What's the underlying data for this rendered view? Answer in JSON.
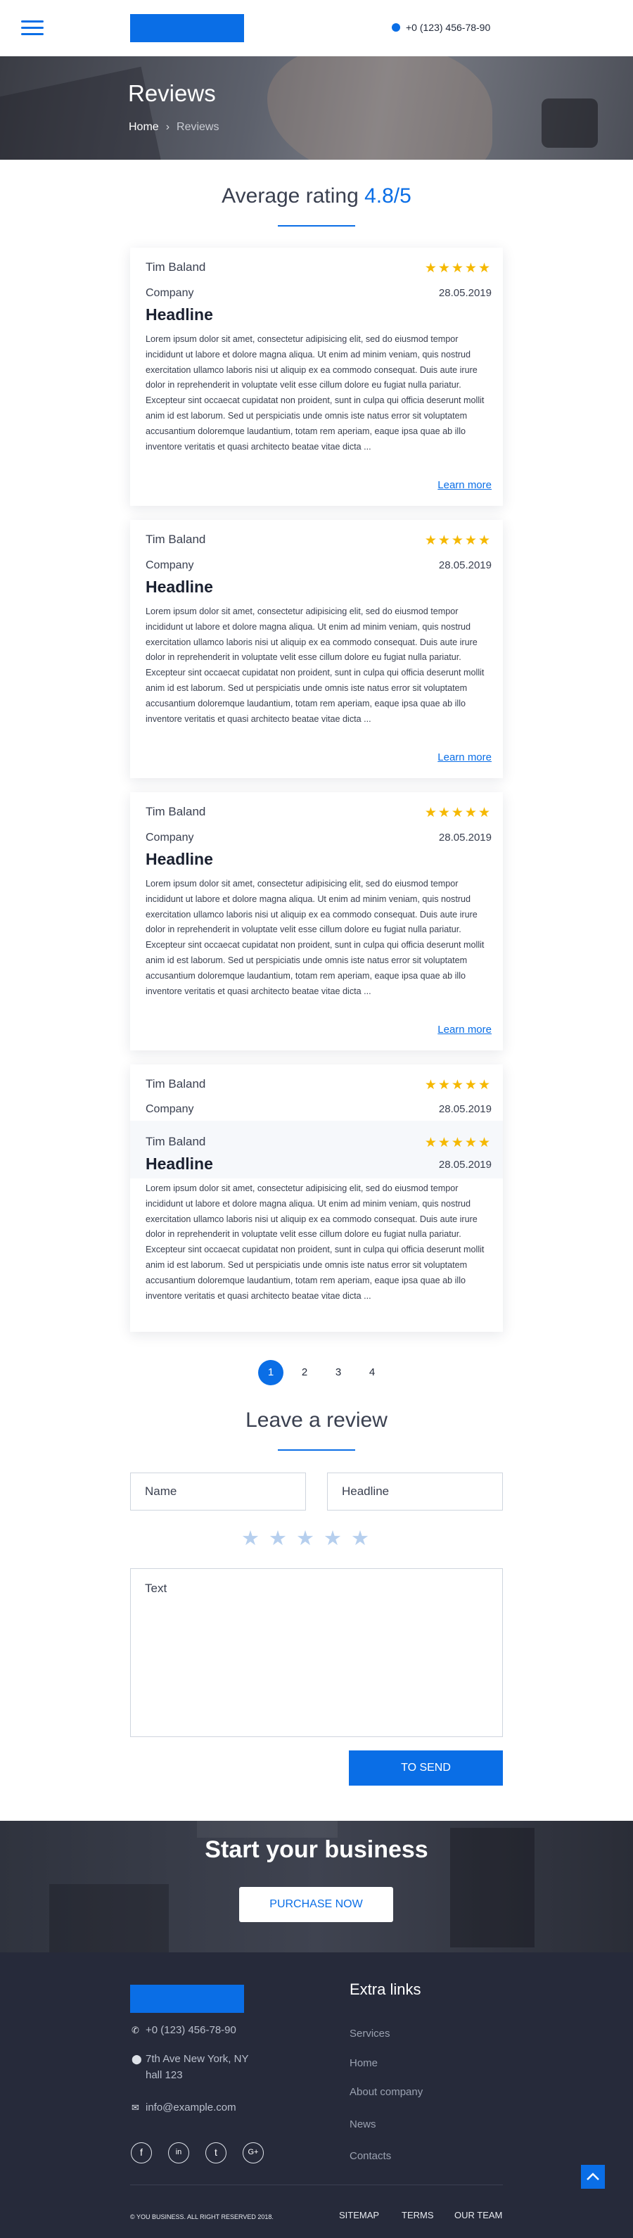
{
  "header": {
    "phone": "+0 (123) 456-78-90"
  },
  "hero": {
    "title": "Reviews",
    "breadcrumb": {
      "home": "Home",
      "separator": "›",
      "current": "Reviews"
    }
  },
  "average": {
    "label": "Average rating",
    "value": "4.8/5"
  },
  "reviews": [
    {
      "name": "Tim Baland",
      "stars": "★★★★★",
      "company": "Company",
      "date": "28.05.2019",
      "headline": "Headline",
      "body": "Lorem ipsum dolor sit amet, consectetur adipisicing elit, sed do eiusmod tempor incididunt ut labore et dolore magna aliqua. Ut enim ad minim veniam, quis nostrud exercitation ullamco laboris nisi ut aliquip ex ea commodo consequat. Duis aute irure dolor in reprehenderit in voluptate velit esse cillum dolore eu fugiat nulla pariatur. Excepteur sint occaecat cupidatat non proident, sunt in culpa qui officia deserunt mollit anim id est laborum. Sed ut perspiciatis unde omnis iste natus error sit voluptatem accusantium doloremque laudantium, totam rem aperiam, eaque ipsa quae ab illo inventore veritatis et quasi architecto beatae vitae dicta ...",
      "more": "Learn more"
    },
    {
      "name": "Tim Baland",
      "stars": "★★★★★",
      "company": "Company",
      "date": "28.05.2019",
      "headline": "Headline",
      "body": "Lorem ipsum dolor sit amet, consectetur adipisicing elit, sed do eiusmod tempor incididunt ut labore et dolore magna aliqua. Ut enim ad minim veniam, quis nostrud exercitation ullamco laboris nisi ut aliquip ex ea commodo consequat. Duis aute irure dolor in reprehenderit in voluptate velit esse cillum dolore eu fugiat nulla pariatur. Excepteur sint occaecat cupidatat non proident, sunt in culpa qui officia deserunt mollit anim id est laborum. Sed ut perspiciatis unde omnis iste natus error sit voluptatem accusantium doloremque laudantium, totam rem aperiam, eaque ipsa quae ab illo inventore veritatis et quasi architecto beatae vitae dicta ...",
      "more": "Learn more"
    },
    {
      "name": "Tim Baland",
      "stars": "★★★★★",
      "company": "Company",
      "date": "28.05.2019",
      "headline": "Headline",
      "body": "Lorem ipsum dolor sit amet, consectetur adipisicing elit, sed do eiusmod tempor incididunt ut labore et dolore magna aliqua. Ut enim ad minim veniam, quis nostrud exercitation ullamco laboris nisi ut aliquip ex ea commodo consequat. Duis aute irure dolor in reprehenderit in voluptate velit esse cillum dolore eu fugiat nulla pariatur. Excepteur sint occaecat cupidatat non proident, sunt in culpa qui officia deserunt mollit anim id est laborum. Sed ut perspiciatis unde omnis iste natus error sit voluptatem accusantium doloremque laudantium, totam rem aperiam, eaque ipsa quae ab illo inventore veritatis et quasi architecto beatae vitae dicta ...",
      "more": "Learn more"
    },
    {
      "name": "Tim Baland",
      "stars": "★★★★★",
      "company": "Company",
      "date": "28.05.2019",
      "name2": "Tim Baland",
      "stars2": "★★★★★",
      "headline": "Headline",
      "date2": "28.05.2019",
      "body": "Lorem ipsum dolor sit amet, consectetur adipisicing elit, sed do eiusmod tempor incididunt ut labore et dolore magna aliqua. Ut enim ad minim veniam, quis nostrud exercitation ullamco laboris nisi ut aliquip ex ea commodo consequat. Duis aute irure dolor in reprehenderit in voluptate velit esse cillum dolore eu fugiat nulla pariatur. Excepteur sint occaecat cupidatat non proident, sunt in culpa qui officia deserunt mollit anim id est laborum. Sed ut perspiciatis unde omnis iste natus error sit voluptatem accusantium doloremque laudantium, totam rem aperiam, eaque ipsa quae ab illo inventore veritatis et quasi architecto beatae vitae dicta ..."
    }
  ],
  "pagination": {
    "pages": [
      "1",
      "2",
      "3",
      "4"
    ],
    "current": "1"
  },
  "leave": {
    "title": "Leave a review",
    "name_placeholder": "Name",
    "headline_placeholder": "Headline",
    "rating_stars": "★★★★★",
    "text_placeholder": "Text",
    "submit": "TO SEND"
  },
  "cta": {
    "title": "Start your business",
    "button": "PURCHASE NOW"
  },
  "footer": {
    "phone": "+0 (123) 456-78-90",
    "address_line1": "7th Ave New York, NY",
    "address_line2": "hall 123",
    "email": "info@example.com",
    "social": [
      "f",
      "in",
      "t",
      "G+"
    ],
    "extra_title": "Extra links",
    "links": [
      "Services",
      "Home",
      "About company",
      "News",
      "Contacts"
    ],
    "copyright": "© YOU BUSINESS. ALL RIGHT RESERVED 2018.",
    "nav": [
      "SITEMAP",
      "TERMS",
      "OUR TEAM"
    ]
  },
  "colors": {
    "accent": "#0a6ee6",
    "star": "#f5b800",
    "footer_bg": "#262a3a"
  },
  "icons": [
    "menu-icon",
    "phone-icon",
    "chevron-right-icon",
    "star-icon",
    "location-icon",
    "mail-icon",
    "facebook-icon",
    "linkedin-icon",
    "twitter-icon",
    "google-plus-icon",
    "arrow-up-icon"
  ]
}
